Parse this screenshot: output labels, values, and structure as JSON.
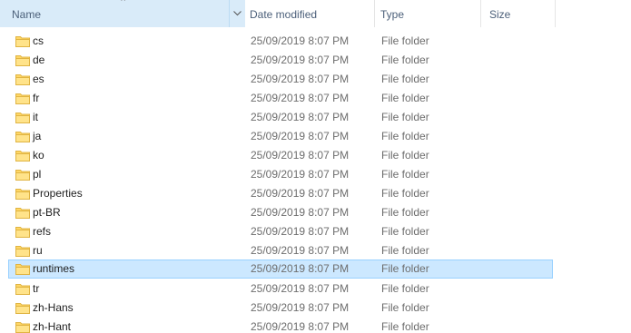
{
  "columns": {
    "name": "Name",
    "date": "Date modified",
    "type": "Type",
    "size": "Size"
  },
  "sort": {
    "column": "Name",
    "direction": "ascending"
  },
  "colors": {
    "header_active_bg": "#d9ebf9",
    "selection_bg": "#cce8ff",
    "selection_border": "#99d1ff",
    "folder_yellow": "#ffd766"
  },
  "icon": "folder-icon",
  "rows": [
    {
      "name": "cs",
      "date": "25/09/2019 8:07 PM",
      "type": "File folder",
      "size": ""
    },
    {
      "name": "de",
      "date": "25/09/2019 8:07 PM",
      "type": "File folder",
      "size": ""
    },
    {
      "name": "es",
      "date": "25/09/2019 8:07 PM",
      "type": "File folder",
      "size": ""
    },
    {
      "name": "fr",
      "date": "25/09/2019 8:07 PM",
      "type": "File folder",
      "size": ""
    },
    {
      "name": "it",
      "date": "25/09/2019 8:07 PM",
      "type": "File folder",
      "size": ""
    },
    {
      "name": "ja",
      "date": "25/09/2019 8:07 PM",
      "type": "File folder",
      "size": ""
    },
    {
      "name": "ko",
      "date": "25/09/2019 8:07 PM",
      "type": "File folder",
      "size": ""
    },
    {
      "name": "pl",
      "date": "25/09/2019 8:07 PM",
      "type": "File folder",
      "size": ""
    },
    {
      "name": "Properties",
      "date": "25/09/2019 8:07 PM",
      "type": "File folder",
      "size": ""
    },
    {
      "name": "pt-BR",
      "date": "25/09/2019 8:07 PM",
      "type": "File folder",
      "size": ""
    },
    {
      "name": "refs",
      "date": "25/09/2019 8:07 PM",
      "type": "File folder",
      "size": ""
    },
    {
      "name": "ru",
      "date": "25/09/2019 8:07 PM",
      "type": "File folder",
      "size": ""
    },
    {
      "name": "runtimes",
      "date": "25/09/2019 8:07 PM",
      "type": "File folder",
      "size": "",
      "selected": true
    },
    {
      "name": "tr",
      "date": "25/09/2019 8:07 PM",
      "type": "File folder",
      "size": ""
    },
    {
      "name": "zh-Hans",
      "date": "25/09/2019 8:07 PM",
      "type": "File folder",
      "size": ""
    },
    {
      "name": "zh-Hant",
      "date": "25/09/2019 8:07 PM",
      "type": "File folder",
      "size": ""
    }
  ]
}
